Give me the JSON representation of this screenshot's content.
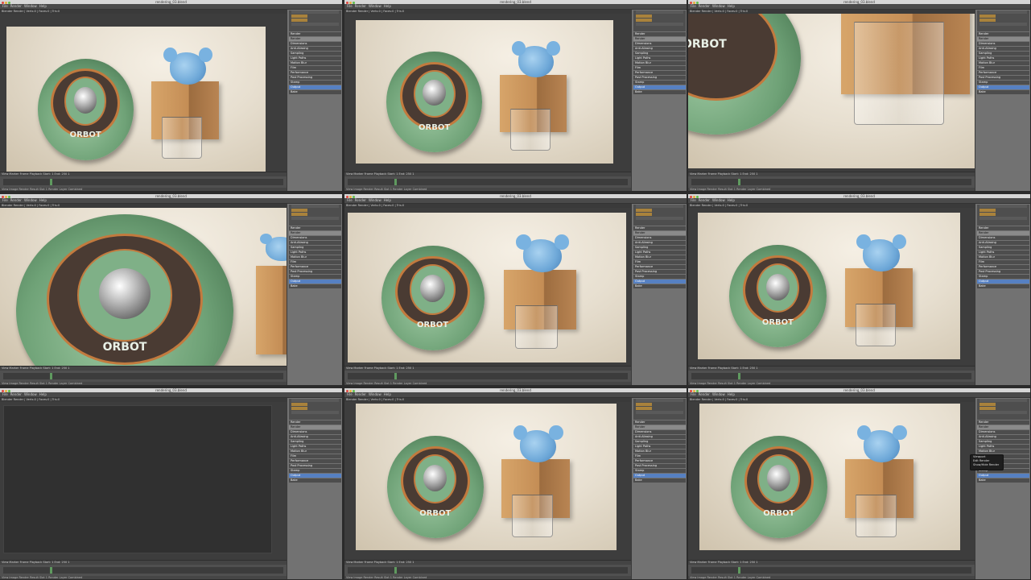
{
  "window_title": "rendering_03.blend",
  "menu": [
    "File",
    "Render",
    "Window",
    "Help"
  ],
  "panels": [
    {
      "id": "p1",
      "info": "Blender Render | Verts:0 | Faces:0 | Tris:0",
      "render": "full",
      "robot_label": "ORBOT"
    },
    {
      "id": "p2",
      "info": "Blender Render | Verts:0 | Faces:0 | Tris:0",
      "render": "full",
      "robot_label": "ORBOT"
    },
    {
      "id": "p3",
      "info": "Blender Render | Verts:0 | Faces:0 | Tris:0",
      "render": "zoom-glass",
      "robot_label": "ORBOT"
    },
    {
      "id": "p4",
      "info": "Blender Render | Verts:0 | Faces:0 | Tris:0",
      "render": "zoom-robot",
      "robot_label": "ORBOT"
    },
    {
      "id": "p5",
      "info": "Blender Render | Verts:0 | Faces:0 | Tris:0",
      "render": "full",
      "robot_label": "ORBOT"
    },
    {
      "id": "p6",
      "info": "Blender Render | Verts:0 | Faces:0 | Tris:0",
      "render": "full",
      "robot_label": "ORBOT"
    },
    {
      "id": "p7",
      "info": "Blender Render | Verts:0 | Faces:0 | Tris:0",
      "render": "empty",
      "robot_label": ""
    },
    {
      "id": "p8",
      "info": "Blender Render | Verts:0 | Faces:0 | Tris:0",
      "render": "full",
      "robot_label": "ORBOT"
    },
    {
      "id": "p9",
      "info": "Blender Render | Verts:0 | Faces:0 | Tris:0",
      "render": "full",
      "robot_label": "ORBOT",
      "popup": true
    }
  ],
  "props_rows": [
    {
      "t": "Render",
      "k": "hdr"
    },
    {
      "t": "Render",
      "k": "field"
    },
    {
      "t": "Dimensions",
      "k": "hdr"
    },
    {
      "t": "Anti-Aliasing",
      "k": "hdr"
    },
    {
      "t": "Sampling",
      "k": "hdr"
    },
    {
      "t": "Light Paths",
      "k": "hdr"
    },
    {
      "t": "Motion Blur",
      "k": "hdr"
    },
    {
      "t": "Film",
      "k": "hdr"
    },
    {
      "t": "Performance",
      "k": "hdr"
    },
    {
      "t": "Post Processing",
      "k": "hdr"
    },
    {
      "t": "Stamp",
      "k": "hdr"
    },
    {
      "t": "Output",
      "k": "sel"
    },
    {
      "t": "Bake",
      "k": "hdr"
    }
  ],
  "timeline": {
    "header": "View  Marker  Frame  Playback  Start: 1  End: 250  1",
    "bottom": "View  Image  Render Result  Slot 1  Render Layer  Combined"
  },
  "popup": [
    "Viewport",
    "Edit Render",
    "Show/Hide Render"
  ]
}
